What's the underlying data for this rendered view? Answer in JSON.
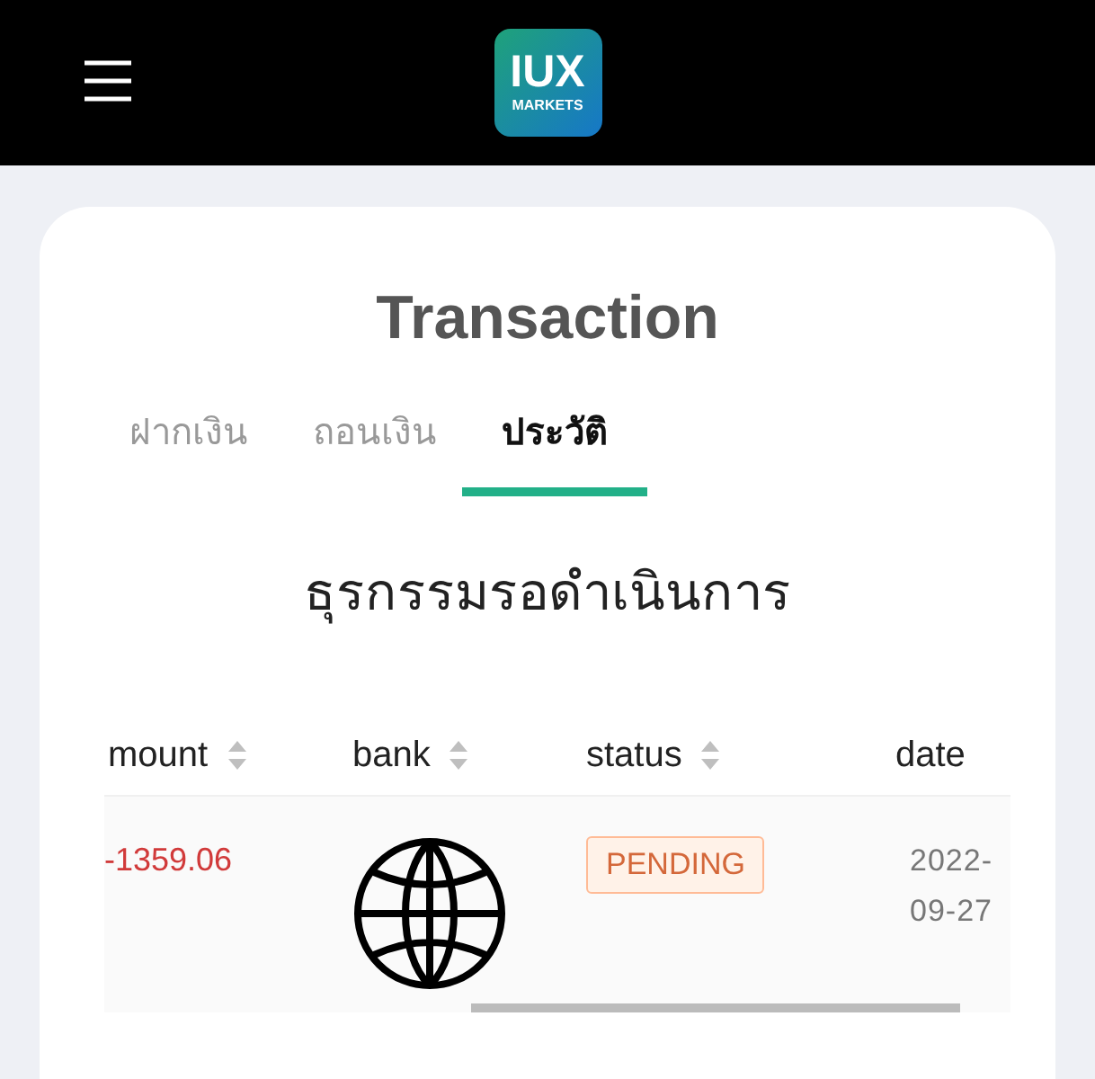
{
  "header": {
    "logo": {
      "line_1": "IUX",
      "line_2": "MARKETS"
    }
  },
  "title": "Transaction",
  "tabs": [
    {
      "label": "ฝากเงิน",
      "selected": false
    },
    {
      "label": "ถอนเงิน",
      "selected": false
    },
    {
      "label": "ประวัติ",
      "selected": true
    }
  ],
  "section_title": "ธุรกรรมรอดำเนินการ",
  "table": {
    "columns": [
      {
        "label": "mount"
      },
      {
        "label": "bank"
      },
      {
        "label": "status"
      },
      {
        "label": "date"
      }
    ],
    "rows": [
      {
        "amount": "-1359.06",
        "status": {
          "label": "PENDING",
          "kind": "pending"
        },
        "date": "2022-09-27"
      }
    ]
  }
}
